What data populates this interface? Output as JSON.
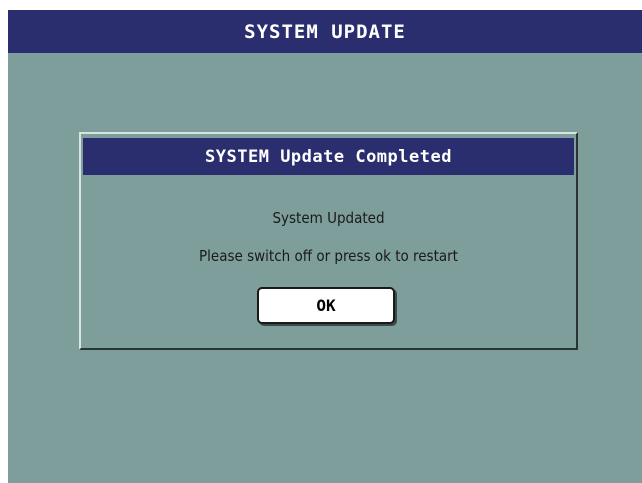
{
  "window": {
    "title": "SYSTEM UPDATE"
  },
  "dialog": {
    "title": "SYSTEM Update Completed",
    "message_line_1": "System Updated",
    "message_line_2": "Please switch off or press ok to restart",
    "ok_label": "OK"
  },
  "colors": {
    "title_bar": "#2a2d6e",
    "background": "#7d9e9b",
    "button": "#ffffff"
  }
}
